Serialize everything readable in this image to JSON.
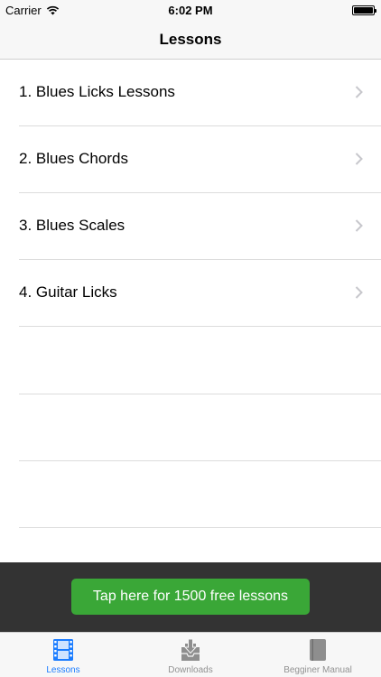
{
  "status_bar": {
    "carrier": "Carrier",
    "time": "6:02 PM"
  },
  "nav": {
    "title": "Lessons"
  },
  "lessons": [
    {
      "label": "1. Blues Licks Lessons"
    },
    {
      "label": "2. Blues Chords"
    },
    {
      "label": "3. Blues Scales"
    },
    {
      "label": "4. Guitar Licks"
    }
  ],
  "banner": {
    "cta_label": "Tap here for 1500 free lessons"
  },
  "tabs": [
    {
      "label": "Lessons",
      "icon": "film-icon",
      "active": true
    },
    {
      "label": "Downloads",
      "icon": "download-tray-icon",
      "active": false
    },
    {
      "label": "Begginer Manual",
      "icon": "book-icon",
      "active": false
    }
  ],
  "colors": {
    "accent": "#1a7cff",
    "cta": "#3aa737",
    "banner_bg": "#333333",
    "inactive_tab": "#929292"
  }
}
